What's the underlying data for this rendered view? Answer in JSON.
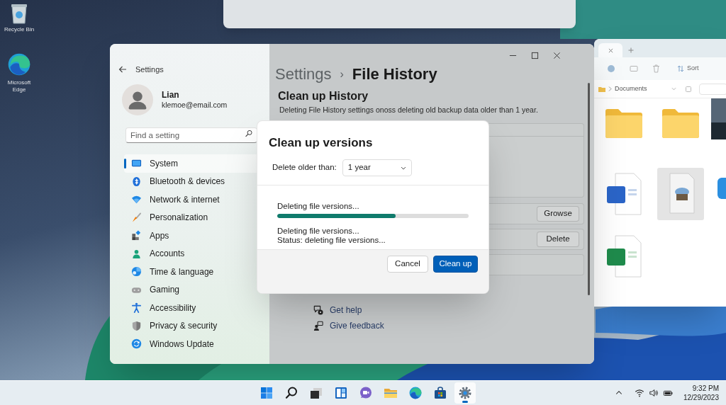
{
  "desktop": {
    "icons": [
      {
        "kind": "recycle_bin",
        "label": "Recycle Bin"
      },
      {
        "kind": "browser",
        "label": "Microsoft Edge"
      }
    ]
  },
  "settings": {
    "title": "Settings",
    "user": {
      "name": "Lian",
      "email": "klemoe@email.com"
    },
    "search": {
      "placeholder": "Find a setting"
    },
    "nav": [
      {
        "kind": "system",
        "label": "System",
        "selected": true
      },
      {
        "kind": "bluetooth",
        "label": "Bluetooth & devices",
        "selected": false
      },
      {
        "kind": "network",
        "label": "Network & internet",
        "selected": false
      },
      {
        "kind": "personalization",
        "label": "Personalization",
        "selected": false
      },
      {
        "kind": "apps",
        "label": "Apps",
        "selected": false
      },
      {
        "kind": "accounts",
        "label": "Accounts",
        "selected": false
      },
      {
        "kind": "time",
        "label": "Time & language",
        "selected": false
      },
      {
        "kind": "gaming",
        "label": "Gaming",
        "selected": false
      },
      {
        "kind": "accessibility",
        "label": "Accessibility",
        "selected": false
      },
      {
        "kind": "privacy",
        "label": "Privacy & security",
        "selected": false
      },
      {
        "kind": "update",
        "label": "Windows Update",
        "selected": false
      }
    ],
    "breadcrumb": {
      "parent": "Settings",
      "separator": "›",
      "current": "File History"
    },
    "section": {
      "title": "Clean up History",
      "description": "Deleting File History settings onoss deleting old backup data older than 1 year."
    },
    "rows": [
      {
        "button": "Growse"
      },
      {
        "button": "Delete"
      }
    ],
    "links": [
      {
        "kind": "help",
        "label": "Get help"
      },
      {
        "kind": "feedback",
        "label": "Give feedback"
      }
    ]
  },
  "dialog": {
    "title": "Clean up versions",
    "field_label": "Delete older than:",
    "dropdown_value": "1 year",
    "progress_label": "Deleting file versions...",
    "level": 0.62,
    "status_lines": [
      "Deleting file versions...",
      "Status: deleting file versions..."
    ],
    "buttons": [
      {
        "kind": "secondary",
        "label": "Cancel"
      },
      {
        "kind": "primary",
        "label": "Clean up"
      }
    ]
  },
  "explorer": {
    "sort_label": "Sort",
    "location": "Documents",
    "items": [
      {
        "kind": "folder"
      },
      {
        "kind": "folder"
      },
      {
        "kind": "photo"
      },
      {
        "kind": "document"
      },
      {
        "kind": "image_file"
      },
      {
        "kind": "app"
      },
      {
        "kind": "spreadsheet"
      }
    ]
  },
  "taskbar": {
    "apps": [
      {
        "kind": "start",
        "selected": false
      },
      {
        "kind": "search",
        "selected": false
      },
      {
        "kind": "task_view",
        "selected": false
      },
      {
        "kind": "widgets",
        "selected": false
      },
      {
        "kind": "chat",
        "selected": false
      },
      {
        "kind": "files",
        "selected": false
      },
      {
        "kind": "browser",
        "selected": false
      },
      {
        "kind": "store",
        "selected": false
      },
      {
        "kind": "settings",
        "selected": true
      }
    ],
    "time": "9:32 PM",
    "date": "12/29/2023"
  }
}
